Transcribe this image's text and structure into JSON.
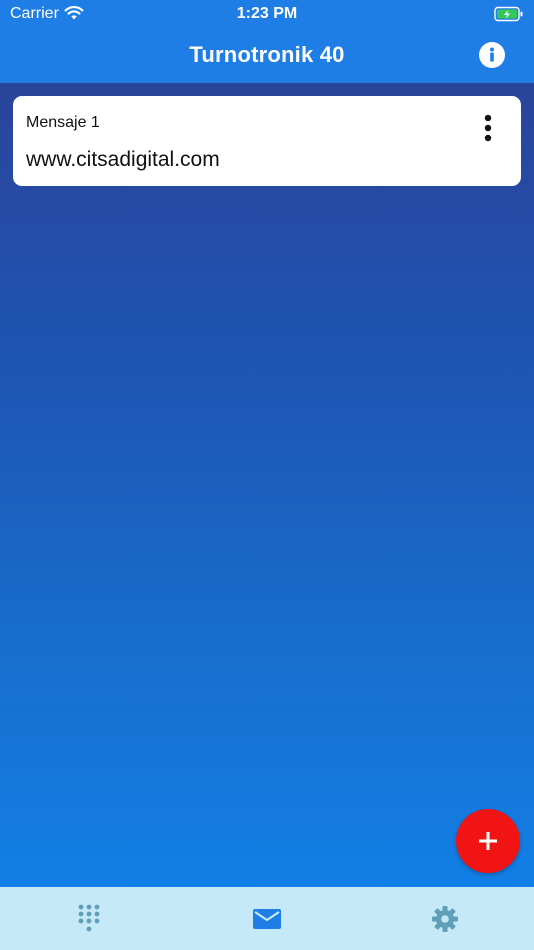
{
  "status_bar": {
    "carrier": "Carrier",
    "time": "1:23 PM",
    "battery_color": "#34c759"
  },
  "app_bar": {
    "title": "Turnotronik 40",
    "info_icon": "info-icon",
    "background": "#1f7ee6"
  },
  "messages": [
    {
      "title": "Mensaje 1",
      "text": "www.citsadigital.com",
      "menu_icon": "more-vertical-icon"
    }
  ],
  "fab": {
    "icon": "plus-icon",
    "color": "#f01414"
  },
  "tab_bar": {
    "tabs": [
      {
        "name": "dialpad",
        "icon": "dialpad-icon",
        "selected": false
      },
      {
        "name": "messages",
        "icon": "mail-icon",
        "selected": true
      },
      {
        "name": "settings",
        "icon": "gear-icon",
        "selected": false
      }
    ],
    "active_color": "#1f7ee6",
    "inactive_color": "#5f9fb8"
  }
}
